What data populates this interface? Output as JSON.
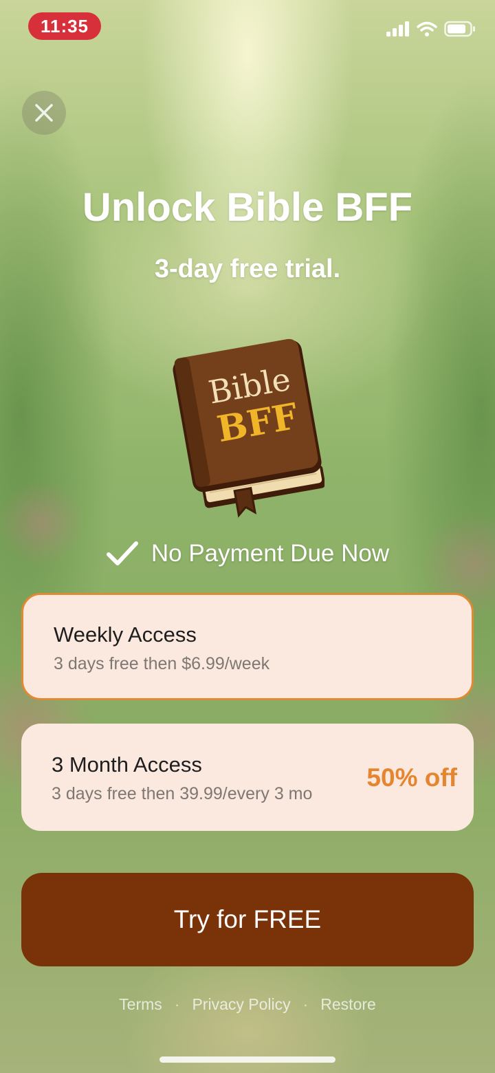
{
  "status_bar": {
    "time": "11:35"
  },
  "header": {
    "title": "Unlock Bible BFF",
    "subtitle": "3-day free trial."
  },
  "logo": {
    "line1": "Bible",
    "line2": "BFF"
  },
  "notice": {
    "text": "No Payment Due Now"
  },
  "plans": [
    {
      "name": "Weekly Access",
      "description": "3 days free then $6.99/week",
      "selected": true
    },
    {
      "name": "3 Month Access",
      "description": "3 days free then 39.99/every 3 mo",
      "badge": "50% off",
      "selected": false
    }
  ],
  "cta": {
    "label": "Try for FREE"
  },
  "footer": {
    "links": [
      "Terms",
      "Privacy Policy",
      "Restore"
    ],
    "separator": "·"
  },
  "colors": {
    "accent": "#e58530",
    "cta_bg": "#7a3208",
    "card_bg": "#fbe9df",
    "time_pill": "#d8303a"
  },
  "icons": [
    "cellular-signal-icon",
    "wifi-icon",
    "battery-icon",
    "close-icon",
    "checkmark-icon"
  ]
}
